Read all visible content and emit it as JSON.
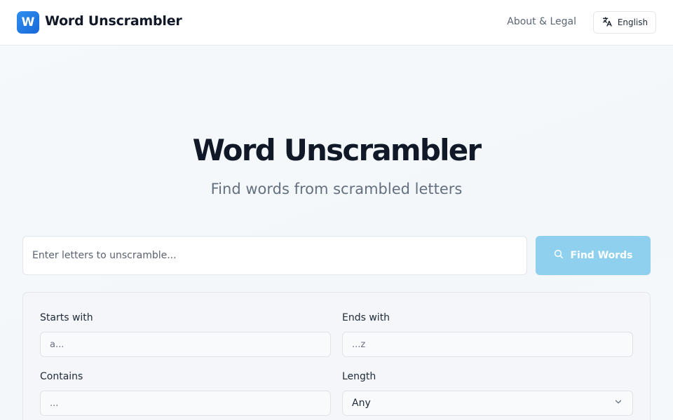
{
  "header": {
    "logo_letter": "W",
    "brand_name": "Word Unscrambler",
    "about_link": "About & Legal",
    "language_label": "English"
  },
  "hero": {
    "title": "Word Unscrambler",
    "subtitle": "Find words from scrambled letters"
  },
  "search": {
    "placeholder": "Enter letters to unscramble...",
    "value": "",
    "button_label": "Find Words"
  },
  "filters": {
    "starts_with": {
      "label": "Starts with",
      "placeholder": "a..."
    },
    "ends_with": {
      "label": "Ends with",
      "placeholder": "...z"
    },
    "contains": {
      "label": "Contains",
      "placeholder": "..."
    },
    "length": {
      "label": "Length",
      "selected": "Any"
    }
  },
  "icons": {
    "language": "translate-icon",
    "find": "search-icon",
    "length_dropdown": "chevron-down-icon"
  },
  "colors": {
    "brand": "#1f7ae6",
    "button": "#8fd0ef",
    "background": "#f4f7fa"
  }
}
